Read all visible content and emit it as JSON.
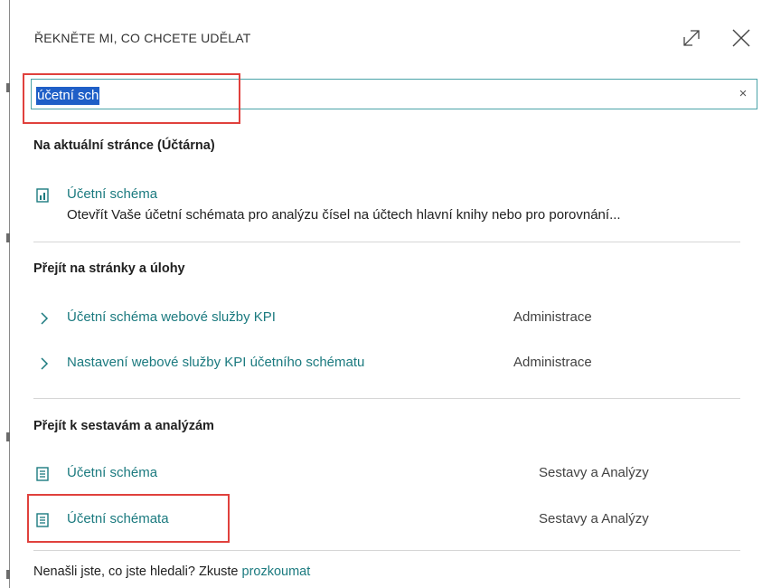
{
  "header": {
    "title": "ŘEKNĚTE MI, CO CHCETE UDĚLAT",
    "expand_icon": "expand-arrows-icon",
    "close_icon": "close-x-icon"
  },
  "search": {
    "value": "účetní sch",
    "clear_label": "×"
  },
  "sections": {
    "current_page": {
      "title": "Na aktuální stránce (Účtárna)",
      "items": [
        {
          "label": "Účetní schéma",
          "description": "Otevřít Vaše účetní schémata pro analýzu čísel na účtech hlavní knihy nebo pro porovnání...",
          "icon": "chart-page-icon"
        }
      ]
    },
    "pages_tasks": {
      "title": "Přejít na stránky a úlohy",
      "items": [
        {
          "label": "Účetní schéma webové služby KPI",
          "category": "Administrace",
          "icon": "chevron-right-icon"
        },
        {
          "label": "Nastavení webové služby KPI účetního schématu",
          "category": "Administrace",
          "icon": "chevron-right-icon"
        }
      ]
    },
    "reports": {
      "title": "Přejít k sestavám a analýzám",
      "items": [
        {
          "label": "Účetní schéma",
          "category": "Sestavy a Analýzy",
          "icon": "report-document-icon"
        },
        {
          "label": "Účetní schémata",
          "category": "Sestavy a Analýzy",
          "icon": "report-document-icon"
        }
      ]
    }
  },
  "footer": {
    "text": "Nenašli jste, co jste hledali? Zkuste ",
    "link": "prozkoumat"
  },
  "colors": {
    "link": "#1b7a7f",
    "highlight_box": "#e0413d",
    "selection": "#1f5fc7",
    "search_border": "#4aa3a8"
  }
}
